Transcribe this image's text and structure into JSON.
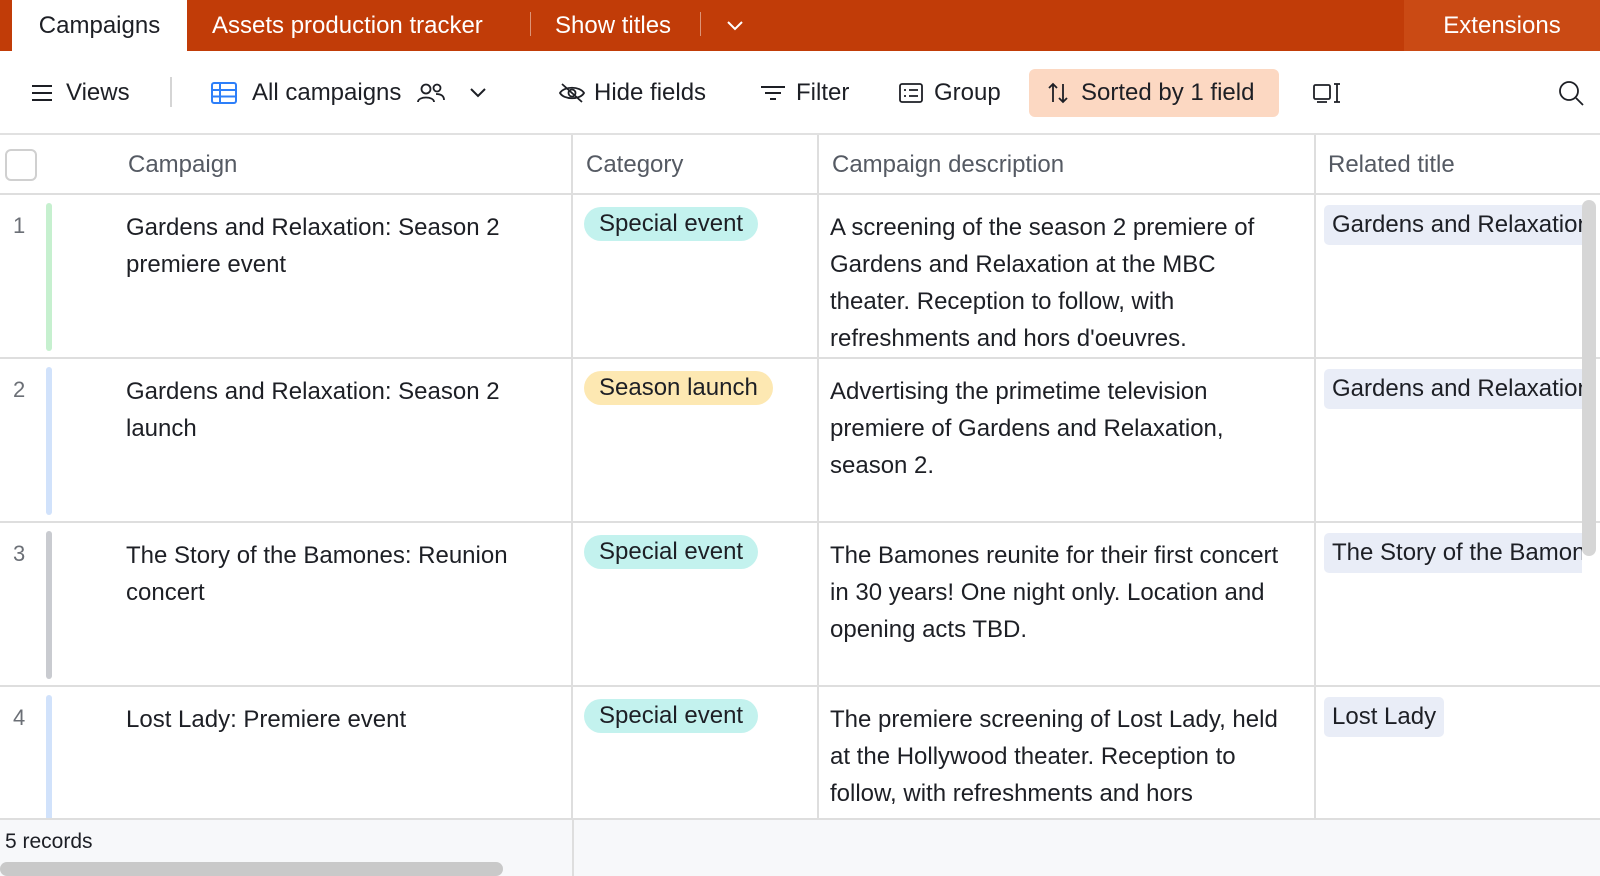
{
  "tabs": {
    "active": "Campaigns",
    "items": [
      "Assets production tracker",
      "Show titles"
    ],
    "extensions": "Extensions"
  },
  "toolbar": {
    "views": "Views",
    "view_name": "All campaigns",
    "hide_fields": "Hide fields",
    "filter": "Filter",
    "group": "Group",
    "sorted": "Sorted by 1 field"
  },
  "table": {
    "columns": [
      "Campaign",
      "Category",
      "Campaign description",
      "Related title"
    ],
    "rows": [
      {
        "num": "1",
        "bar_color": "#c6f0cf",
        "campaign": "Gardens and Relaxation: Season 2 premiere event",
        "category": "Special event",
        "category_color": "#c3f2ee",
        "description": "A screening of the season 2 premiere of Gardens and Relaxation at the MBC theater. Reception to follow, with refreshments and hors d'oeuvres.",
        "related": "Gardens and Relaxation"
      },
      {
        "num": "2",
        "bar_color": "#d1e2fb",
        "campaign": "Gardens and Relaxation: Season 2 launch",
        "category": "Season launch",
        "category_color": "#fde8b2",
        "description": "Advertising the primetime television premiere of Gardens and Relaxation, season 2.",
        "related": "Gardens and Relaxation"
      },
      {
        "num": "3",
        "bar_color": "#c9cbd0",
        "campaign": "The Story of the Bamones: Reunion concert",
        "category": "Special event",
        "category_color": "#c3f2ee",
        "description": "The Bamones reunite for their first concert in 30 years! One night only. Location and opening acts TBD.",
        "related": "The Story of the Bamones"
      },
      {
        "num": "4",
        "bar_color": "#d1e2fb",
        "campaign": "Lost Lady: Premiere event",
        "category": "Special event",
        "category_color": "#c3f2ee",
        "description": "The premiere screening of Lost Lady, held at the Hollywood theater. Reception to follow, with refreshments and hors",
        "related": "Lost Lady"
      }
    ]
  },
  "footer": {
    "record_count": "5 records"
  }
}
